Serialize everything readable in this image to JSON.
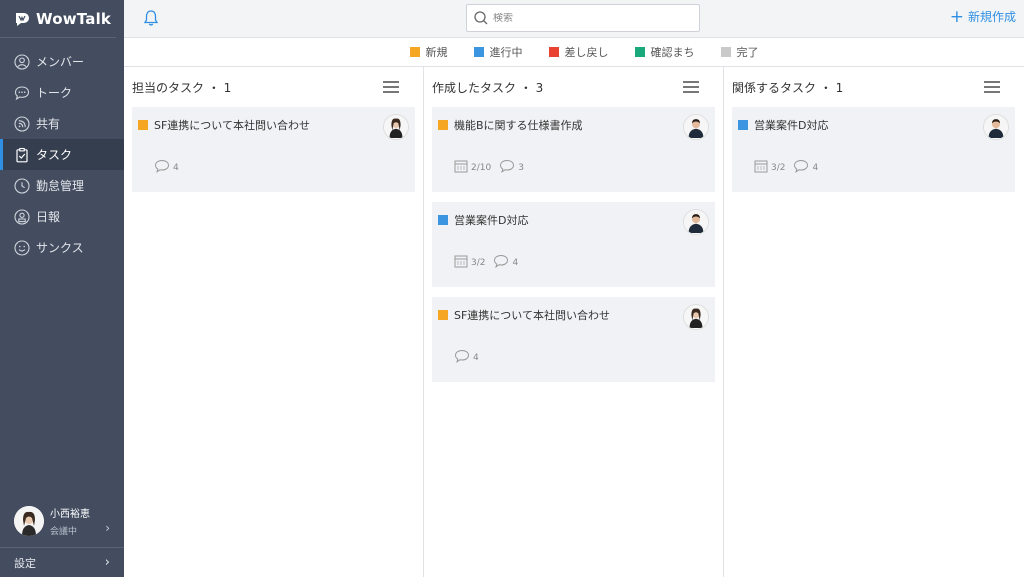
{
  "app": {
    "name": "WowTalk"
  },
  "nav": {
    "items": [
      {
        "label": "メンバー",
        "icon": "person-circle-icon"
      },
      {
        "label": "トーク",
        "icon": "chat-bubble-icon"
      },
      {
        "label": "共有",
        "icon": "rss-icon"
      },
      {
        "label": "タスク",
        "icon": "clipboard-check-icon",
        "active": true
      },
      {
        "label": "勤怠管理",
        "icon": "clock-icon"
      },
      {
        "label": "日報",
        "icon": "person-badge-icon"
      },
      {
        "label": "サンクス",
        "icon": "smile-icon"
      }
    ]
  },
  "user": {
    "name": "小西裕恵",
    "status": "会議中"
  },
  "settings": {
    "label": "設定"
  },
  "header": {
    "search_placeholder": "検索",
    "new_label": "新規作成"
  },
  "legend": [
    {
      "label": "新規",
      "color": "#f5a623"
    },
    {
      "label": "進行中",
      "color": "#3b95e0"
    },
    {
      "label": "差し戻し",
      "color": "#e9432f"
    },
    {
      "label": "確認まち",
      "color": "#1aa97a"
    },
    {
      "label": "完了",
      "color": "#c9c9c9"
    }
  ],
  "columns": [
    {
      "title": "担当のタスク ・ 1",
      "cards": [
        {
          "title": "SF連携について本社問い合わせ",
          "color": "#f5a623",
          "date": "",
          "comments": "4",
          "avatar": "woman"
        }
      ]
    },
    {
      "title": "作成したタスク ・ 3",
      "cards": [
        {
          "title": "機能Bに関する仕様書作成",
          "color": "#f5a623",
          "date": "2/10",
          "comments": "3",
          "avatar": "man"
        },
        {
          "title": "営業案件D対応",
          "color": "#3b95e0",
          "date": "3/2",
          "comments": "4",
          "avatar": "man"
        },
        {
          "title": "SF連携について本社問い合わせ",
          "color": "#f5a623",
          "date": "",
          "comments": "4",
          "avatar": "woman"
        }
      ]
    },
    {
      "title": "関係するタスク ・ 1",
      "cards": [
        {
          "title": "営業案件D対応",
          "color": "#3b95e0",
          "date": "3/2",
          "comments": "4",
          "avatar": "man"
        }
      ]
    }
  ]
}
